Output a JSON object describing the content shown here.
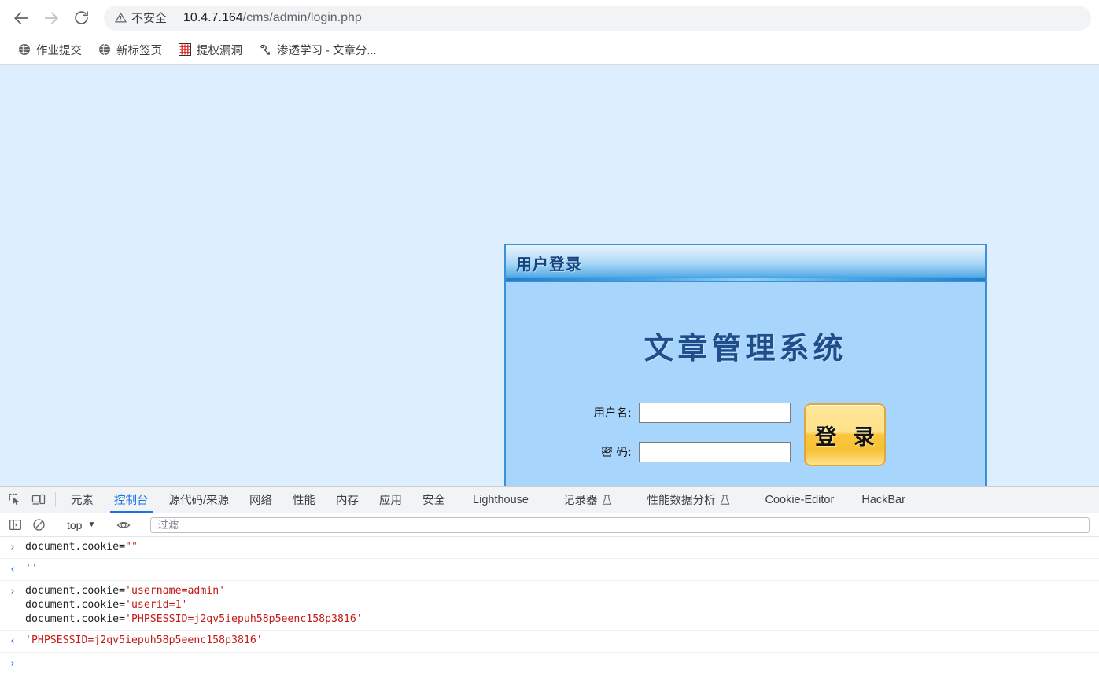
{
  "browser": {
    "nav": {
      "back_icon": "arrow-left-icon",
      "forward_icon": "arrow-right-icon",
      "reload_icon": "reload-icon"
    },
    "omnibox": {
      "security_icon": "warning-triangle-icon",
      "security_label": "不安全",
      "url_host": "10.4.7.164",
      "url_path": "/cms/admin/login.php",
      "full_url": "10.4.7.164/cms/admin/login.php"
    },
    "bookmarks": [
      {
        "label": "作业提交",
        "icon": "globe-icon"
      },
      {
        "label": "新标签页",
        "icon": "globe-icon"
      },
      {
        "label": "提权漏洞",
        "icon": "red-grid-icon"
      },
      {
        "label": "渗透学习 - 文章分...",
        "icon": "hook-icon"
      }
    ]
  },
  "page": {
    "background_color": "#ddeefe",
    "panel": {
      "header_title": "用户登录",
      "app_title": "文章管理系统",
      "title_color": "#1f4e8c",
      "body_color": "#a8d5fb",
      "border_color": "#3d8fd6",
      "fields": [
        {
          "label": "用户名:",
          "value": "",
          "placeholder": "",
          "name": "username"
        },
        {
          "label": "密 码:",
          "value": "",
          "placeholder": "",
          "name": "password"
        }
      ],
      "submit_label": "登 录",
      "submit_color": "#fbc63f"
    }
  },
  "devtools": {
    "left_icons": [
      {
        "name": "inspect-element-icon"
      },
      {
        "name": "device-toolbar-icon"
      }
    ],
    "tabs": [
      {
        "label": "元素",
        "active": false,
        "flask": false
      },
      {
        "label": "控制台",
        "active": true,
        "flask": false
      },
      {
        "label": "源代码/来源",
        "active": false,
        "flask": false
      },
      {
        "label": "网络",
        "active": false,
        "flask": false
      },
      {
        "label": "性能",
        "active": false,
        "flask": false
      },
      {
        "label": "内存",
        "active": false,
        "flask": false
      },
      {
        "label": "应用",
        "active": false,
        "flask": false
      },
      {
        "label": "安全",
        "active": false,
        "flask": false
      },
      {
        "label": "Lighthouse",
        "active": false,
        "flask": false
      },
      {
        "label": "记录器",
        "active": false,
        "flask": true
      },
      {
        "label": "性能数据分析",
        "active": false,
        "flask": true
      },
      {
        "label": "Cookie-Editor",
        "active": false,
        "flask": false
      },
      {
        "label": "HackBar",
        "active": false,
        "flask": false
      }
    ],
    "filterbar": {
      "sidebar_icon": "console-sidebar-icon",
      "clear_icon": "clear-console-icon",
      "context_value": "top",
      "eye_icon": "live-expression-eye-icon",
      "filter_placeholder": "过滤",
      "filter_value": ""
    },
    "console_rows": [
      {
        "kind": "input",
        "arrow": "›",
        "lines": [
          [
            {
              "t": "document.cookie=",
              "c": "plain"
            },
            {
              "t": "\"\"",
              "c": "str"
            }
          ]
        ]
      },
      {
        "kind": "output",
        "arrow": "‹",
        "lines": [
          [
            {
              "t": "''",
              "c": "str"
            }
          ]
        ]
      },
      {
        "kind": "input",
        "arrow": "›",
        "lines": [
          [
            {
              "t": "document.cookie=",
              "c": "plain"
            },
            {
              "t": "'username=admin'",
              "c": "str"
            }
          ],
          [
            {
              "t": "document.cookie=",
              "c": "plain"
            },
            {
              "t": "'userid=1'",
              "c": "str"
            }
          ],
          [
            {
              "t": "document.cookie=",
              "c": "plain"
            },
            {
              "t": "'PHPSESSID=j2qv5iepuh58p5eenc158p3816'",
              "c": "str"
            }
          ]
        ]
      },
      {
        "kind": "output",
        "arrow": "‹",
        "lines": [
          [
            {
              "t": "'PHPSESSID=j2qv5iepuh58p5eenc158p3816'",
              "c": "str"
            }
          ]
        ]
      }
    ],
    "prompt_arrow": "›"
  }
}
